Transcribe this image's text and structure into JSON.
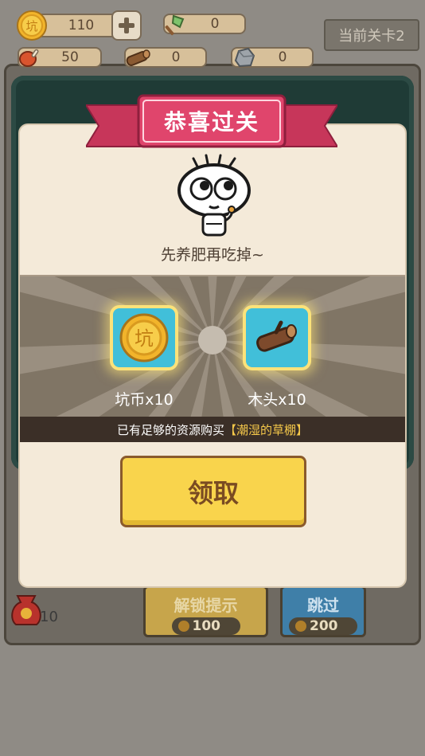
{
  "resources": {
    "coin": "110",
    "axe": "0",
    "meat": "50",
    "wood": "0",
    "stone": "0",
    "coin_glyph": "坑"
  },
  "level_tag": "当前关卡2",
  "background": {
    "bag_count": "10",
    "hint_button": {
      "label": "解锁提示",
      "cost": "100"
    },
    "skip_button": {
      "label": "跳过",
      "cost": "200"
    }
  },
  "modal": {
    "title": "恭喜过关",
    "subtitle": "先养肥再吃掉~",
    "rewards": [
      {
        "label": "坑币x10",
        "icon": "coin-icon",
        "glyph": "坑"
      },
      {
        "label": "木头x10",
        "icon": "wood-log-icon"
      }
    ],
    "notice_prefix": "已有足够的资源购买",
    "notice_highlight": "【潮湿的草棚】",
    "claim_label": "领取"
  },
  "colors": {
    "ribbon": "#e0456c",
    "claim_button": "#f9d44c",
    "reward_box": "#41bfd9",
    "highlight": "#f6c94a"
  }
}
